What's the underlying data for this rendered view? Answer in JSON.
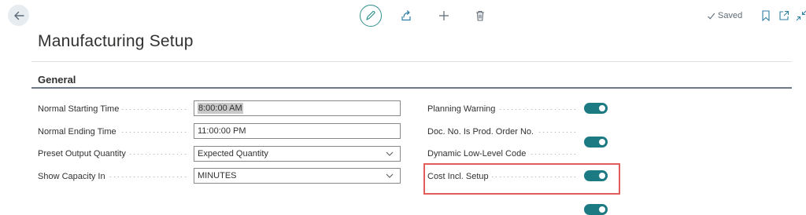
{
  "header": {
    "title": "Manufacturing Setup",
    "saved_label": "Saved"
  },
  "icons": {
    "back": "arrow-left-icon",
    "edit": "pencil-icon",
    "share": "share-icon",
    "new": "plus-icon",
    "delete": "trash-icon",
    "saved": "checkmark-icon",
    "bookmark": "bookmark-icon",
    "open_new_window": "open-new-window-icon",
    "collapse": "collapse-icon"
  },
  "section": {
    "title": "General"
  },
  "left_fields": [
    {
      "label": "Normal Starting Time",
      "value": "8:00:00 AM",
      "type": "text",
      "selected": true
    },
    {
      "label": "Normal Ending Time",
      "value": "11:00:00 PM",
      "type": "text",
      "selected": false
    },
    {
      "label": "Preset Output Quantity",
      "value": "Expected Quantity",
      "type": "select",
      "selected": false
    },
    {
      "label": "Show Capacity In",
      "value": "MINUTES",
      "type": "select",
      "selected": false
    }
  ],
  "right_fields": [
    {
      "label": "Planning Warning",
      "value": true
    },
    {
      "label": "Doc. No. Is Prod. Order No.",
      "value": true
    },
    {
      "label": "Dynamic Low-Level Code",
      "value": true
    },
    {
      "label": "Cost Incl. Setup",
      "value": true
    }
  ],
  "colors": {
    "accent": "#1c7a82",
    "highlight": "#e25c5c"
  }
}
